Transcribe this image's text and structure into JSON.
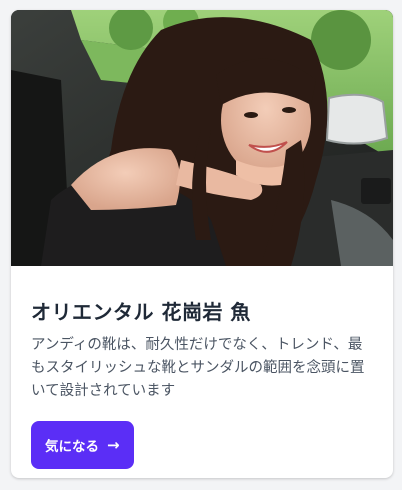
{
  "card": {
    "title": "オリエンタル 花崗岩 魚",
    "description": "アンディの靴は、耐久性だけでなく、トレンド、最もスタイリッシュな靴とサンダルの範囲を念頭に置いて設計されています",
    "cta": {
      "label": "気になる",
      "icon": "arrow-right-icon",
      "glyph": "→"
    }
  },
  "colors": {
    "accent": "#5b2ef6",
    "title": "#1f2937",
    "text": "#4b5563",
    "page": "#f3f4f6"
  }
}
